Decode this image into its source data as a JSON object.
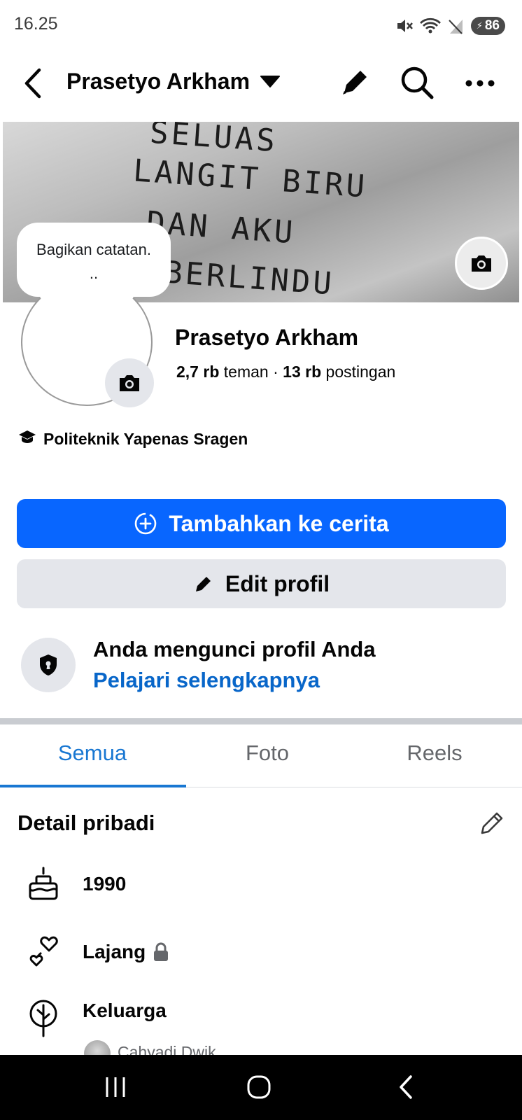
{
  "status_bar": {
    "time": "16.25",
    "battery": "86",
    "icons": [
      "mute-icon",
      "wifi-icon",
      "no-signal-icon",
      "battery-icon"
    ]
  },
  "header": {
    "title": "Prasetyo Arkham",
    "icons": [
      "back-icon",
      "caret-down-icon",
      "pencil-icon",
      "search-icon",
      "more-icon"
    ]
  },
  "cover": {
    "lines": [
      "SELUAS",
      "LANGIT BIRU",
      "DAN AKU",
      "BERLINDU"
    ]
  },
  "note": {
    "line1": "Bagikan catatan.",
    "line2": ".."
  },
  "profile": {
    "name": "Prasetyo Arkham",
    "friends_count": "2,7 rb",
    "friends_label": "teman",
    "separator": "·",
    "posts_count": "13 rb",
    "posts_label": "postingan",
    "education": "Politeknik Yapenas Sragen"
  },
  "actions": {
    "story_label": "Tambahkan ke cerita",
    "edit_label": "Edit profil"
  },
  "lock_info": {
    "title": "Anda mengunci profil Anda",
    "link": "Pelajari selengkapnya"
  },
  "tabs": [
    {
      "label": "Semua",
      "active": true
    },
    {
      "label": "Foto",
      "active": false
    },
    {
      "label": "Reels",
      "active": false
    }
  ],
  "details": {
    "title": "Detail pribadi",
    "items": [
      {
        "icon": "birthday-cake-icon",
        "text": "1990"
      },
      {
        "icon": "hearts-icon",
        "text": "Lajang"
      },
      {
        "icon": "family-tree-icon",
        "text": "Keluarga"
      }
    ],
    "family_member": "Cahyadi Dwik"
  },
  "colors": {
    "primary_blue": "#0866ff",
    "tab_blue": "#1877d2",
    "link_blue": "#0866c9",
    "secondary_bg": "#e4e6eb",
    "text_secondary": "#65676b"
  }
}
